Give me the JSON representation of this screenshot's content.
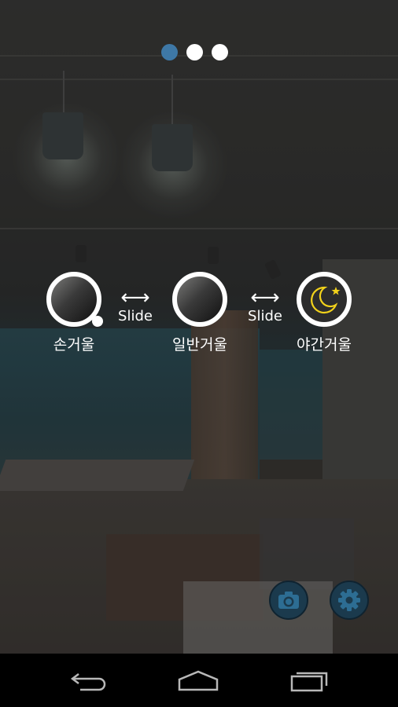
{
  "pager": {
    "pages": 3,
    "active_index": 0
  },
  "modes": [
    {
      "label": "손거울",
      "icon": "hand-mirror-icon"
    },
    {
      "label": "일반거울",
      "icon": "mirror-icon"
    },
    {
      "label": "야간거울",
      "icon": "night-mirror-icon"
    }
  ],
  "slide_hints": [
    {
      "arrow": "⟷",
      "text": "Slide"
    },
    {
      "arrow": "⟷",
      "text": "Slide"
    }
  ],
  "actions": {
    "camera_icon": "camera-icon",
    "settings_icon": "gear-icon"
  },
  "navbar": {
    "back_icon": "back-icon",
    "home_icon": "home-icon",
    "recents_icon": "recents-icon"
  },
  "colors": {
    "active_dot": "#3e78a6",
    "fab_background": "#1b3a4d",
    "fab_icon": "#2d6d93",
    "moon": "#f2d21b"
  }
}
